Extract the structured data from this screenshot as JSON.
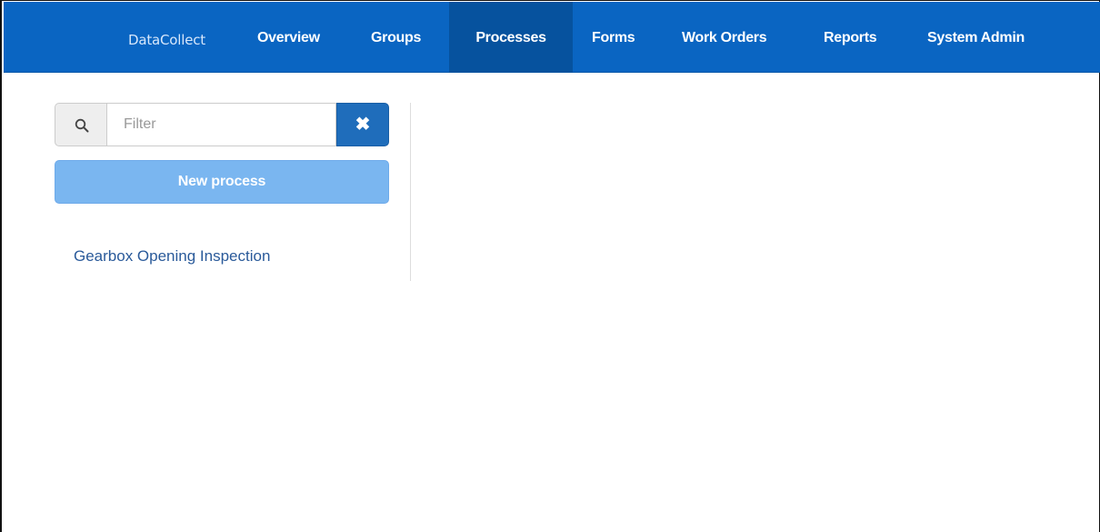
{
  "navbar": {
    "brand": "DataCollect",
    "items": [
      {
        "label": "Overview",
        "active": false
      },
      {
        "label": "Groups",
        "active": false
      },
      {
        "label": "Processes",
        "active": true
      },
      {
        "label": "Forms",
        "active": false
      },
      {
        "label": "Work Orders",
        "active": false
      },
      {
        "label": "Reports",
        "active": false
      },
      {
        "label": "System Admin",
        "active": false
      }
    ]
  },
  "sidebar": {
    "filter": {
      "placeholder": "Filter",
      "value": "",
      "search_icon": "search-icon",
      "clear_icon": "close-icon",
      "clear_glyph": "✖"
    },
    "new_button_label": "New process",
    "processes": [
      {
        "label": "Gearbox Opening Inspection"
      }
    ]
  },
  "colors": {
    "navbar_bg": "#0a65c2",
    "nav_active_bg": "#06529e",
    "button_primary": "#1f6dbb",
    "button_new_disabled": "#7ab6f0",
    "link": "#2a5a9a"
  }
}
